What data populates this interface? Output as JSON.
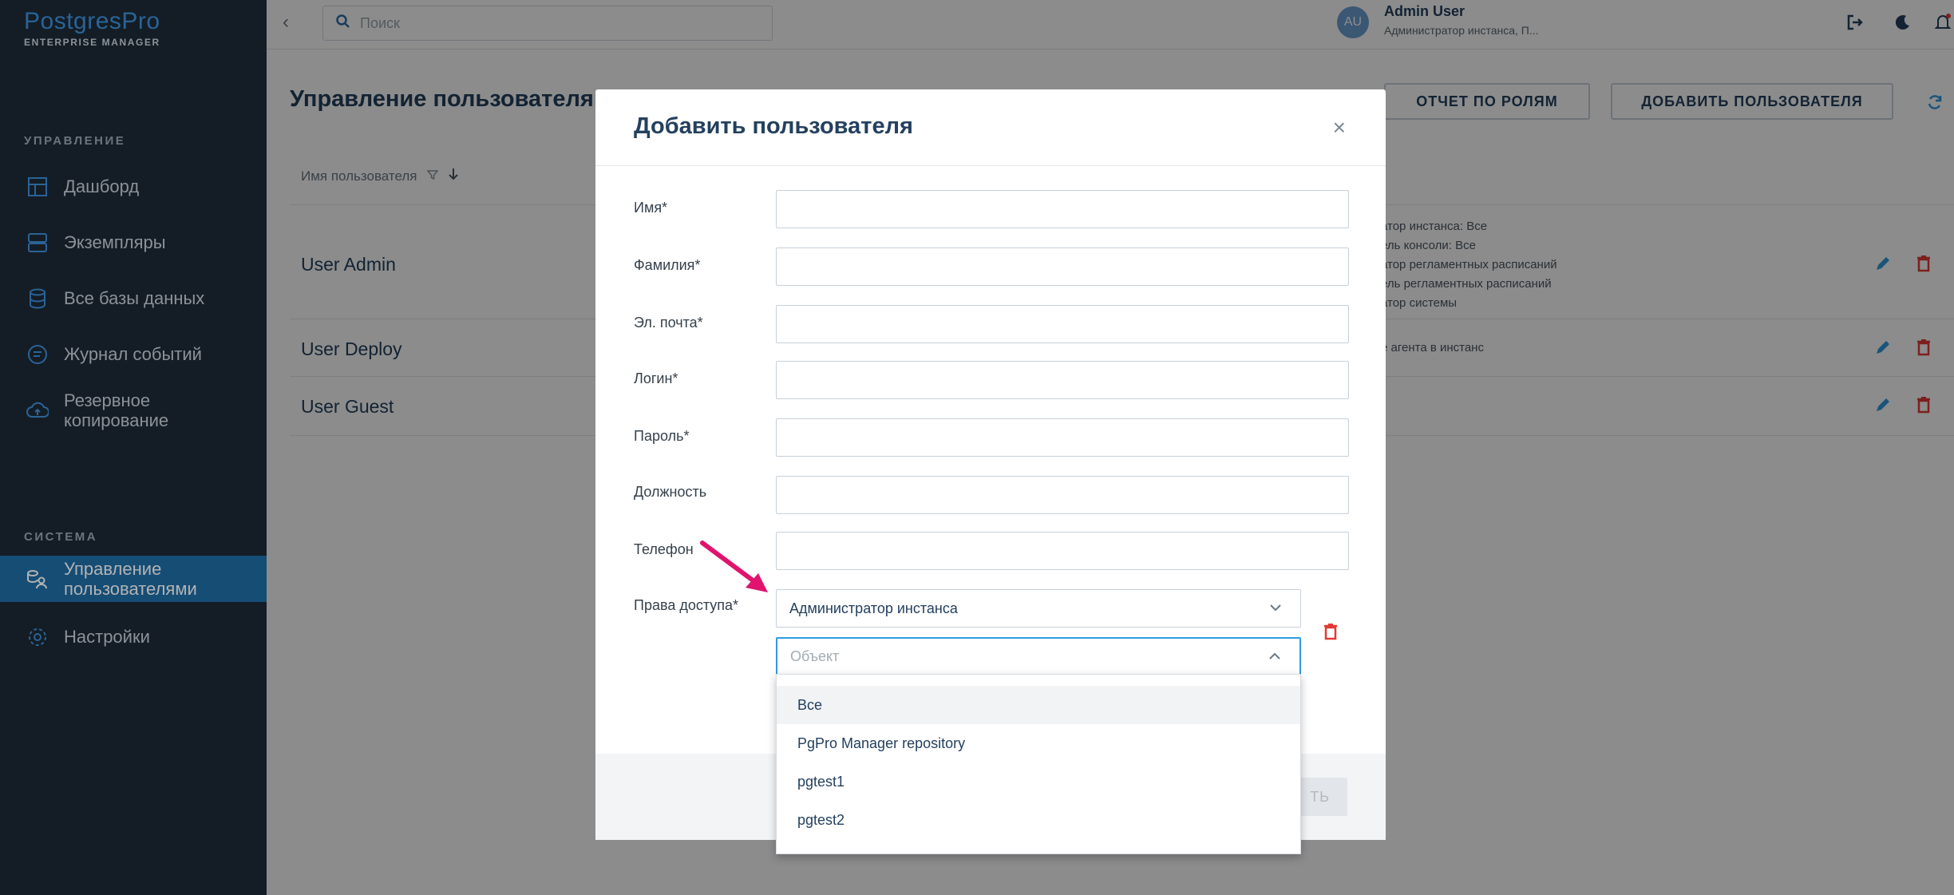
{
  "app": {
    "logo_main": "PostgresPro",
    "logo_sub": "ENTERPRISE MANAGER"
  },
  "sidebar": {
    "section_manage": "УПРАВЛЕНИЕ",
    "section_system": "СИСТЕМА",
    "items": [
      {
        "label": "Дашборд",
        "icon": "dashboard-icon"
      },
      {
        "label": "Экземпляры",
        "icon": "instances-icon"
      },
      {
        "label": "Все базы данных",
        "icon": "database-icon"
      },
      {
        "label": "Журнал событий",
        "icon": "events-icon"
      },
      {
        "label_line1": "Резервное",
        "label_line2": "копирование",
        "icon": "cloud-backup-icon"
      },
      {
        "label_line1": "Управление",
        "label_line2": "пользователями",
        "icon": "users-icon",
        "active": true
      },
      {
        "label": "Настройки",
        "icon": "gear-icon"
      }
    ]
  },
  "topbar": {
    "search_placeholder": "Поиск",
    "avatar_initials": "AU",
    "user_name": "Admin User",
    "user_role": "Администратор инстанса, П..."
  },
  "page": {
    "title": "Управление пользователями",
    "role_report_button": "ОТЧЕТ ПО РОЛЯМ",
    "add_user_button": "ДОБАВИТЬ ПОЛЬЗОВАТЕЛЯ",
    "column_username": "Имя пользователя",
    "rows": [
      {
        "name": "User Admin",
        "roles": [
          "атор инстанса: Все",
          "ель консоли: Все",
          "атор регламентных расписаний",
          "ель регламентных расписаний",
          "атор системы"
        ]
      },
      {
        "name": "User Deploy",
        "roles": [
          "е агента в инстанс"
        ]
      },
      {
        "name": "User Guest",
        "roles": []
      }
    ]
  },
  "modal": {
    "title": "Добавить пользователя",
    "close": "×",
    "fields": {
      "first_name": "Имя*",
      "last_name": "Фамилия*",
      "email": "Эл. почта*",
      "login": "Логин*",
      "password": "Пароль*",
      "position": "Должность",
      "phone": "Телефон",
      "access": "Права доступа*"
    },
    "access_role_value": "Администратор инстанса",
    "object_placeholder": "Объект",
    "footer_button_partial": "ТЬ",
    "dropdown_options": [
      "Все",
      "PgPro Manager repository",
      "pgtest1",
      "pgtest2"
    ]
  },
  "colors": {
    "sidebar_bg": "#1d2a36",
    "active_nav": "#1f6fa8",
    "accent": "#2f9ae0",
    "title": "#24405e",
    "annotation_arrow": "#e0146e",
    "delete_red": "#e53935"
  }
}
